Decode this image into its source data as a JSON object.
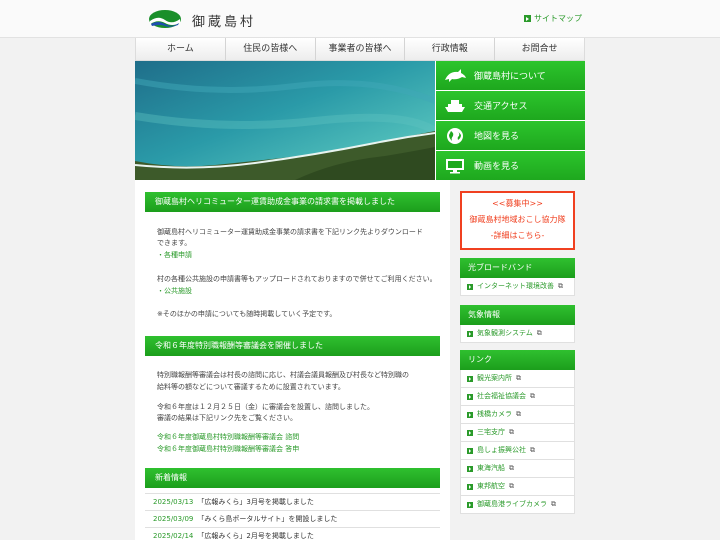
{
  "header": {
    "title": "御蔵島村",
    "sitemap_label": "サイトマップ"
  },
  "gnav": [
    "ホーム",
    "住民の皆様へ",
    "事業者の皆様へ",
    "行政情報",
    "お問合せ"
  ],
  "quick_links": [
    {
      "label": "御蔵島村について",
      "icon": "dolphin-icon"
    },
    {
      "label": "交通アクセス",
      "icon": "ship-icon"
    },
    {
      "label": "地図を見る",
      "icon": "globe-icon"
    },
    {
      "label": "動画を見る",
      "icon": "monitor-icon"
    }
  ],
  "sections": {
    "heli": {
      "title": "御蔵島村ヘリコミューター運賃助成金事業の請求書を掲載しました",
      "p1a": "御蔵島村ヘリコミューター運賃助成金事業の請求書を下記リンク先よりダウンロード",
      "p1b": "できます。",
      "l1": "・各種申請",
      "p2": "村の各種公共施設の申請書等もアップロードされておりますので併せてご利用ください。",
      "l2": "・公共施設",
      "p3": "※そのほかの申請についても随時掲載していく予定です。"
    },
    "council": {
      "title": "令和６年度特別職報酬等審議会を開催しました",
      "p1a": "特別職報酬等審議会は村長の諮問に応じ、村議会議員報酬及び村長など特別職の",
      "p1b": "給料等の額などについて審議するために設置されています。",
      "p2a": "令和６年度は１２月２５日（金）に審議会を設置し、諮問しました。",
      "p2b": "審議の結果は下記リンク先をご覧ください。",
      "l1": "令和６年度御蔵島村特別職報酬等審議会 諮問",
      "l2": "令和６年度御蔵島村特別職報酬等審議会 答申"
    },
    "news": {
      "title": "新着情報",
      "items": [
        {
          "date": "2025/03/13",
          "text": "「広報みくら」3月号を掲載しました"
        },
        {
          "date": "2025/03/09",
          "text": "「みくら島ポータルサイト」を開設しました"
        },
        {
          "date": "2025/02/14",
          "text": "「広報みくら」2月号を掲載しました"
        }
      ]
    }
  },
  "recruit": {
    "line1": "<<募集中>>",
    "line2": "御蔵島村地域おこし協力隊",
    "line3": "-詳細はこちら-"
  },
  "sidebar": {
    "broadband": {
      "title": "光ブロードバンド",
      "items": [
        "インターネット環境改善"
      ]
    },
    "weather": {
      "title": "気象情報",
      "items": [
        "気象観測システム"
      ]
    },
    "links": {
      "title": "リンク",
      "items": [
        "観光案内所",
        "社会福祉協議会",
        "桟橋カメラ",
        "三宅支庁",
        "島しょ振興公社",
        "東海汽船",
        "東邦航空",
        "御蔵島港ライブカメラ"
      ]
    }
  },
  "colors": {
    "accent": "#1ea81e",
    "link": "#2a9a2a",
    "recruit": "#f04020"
  }
}
